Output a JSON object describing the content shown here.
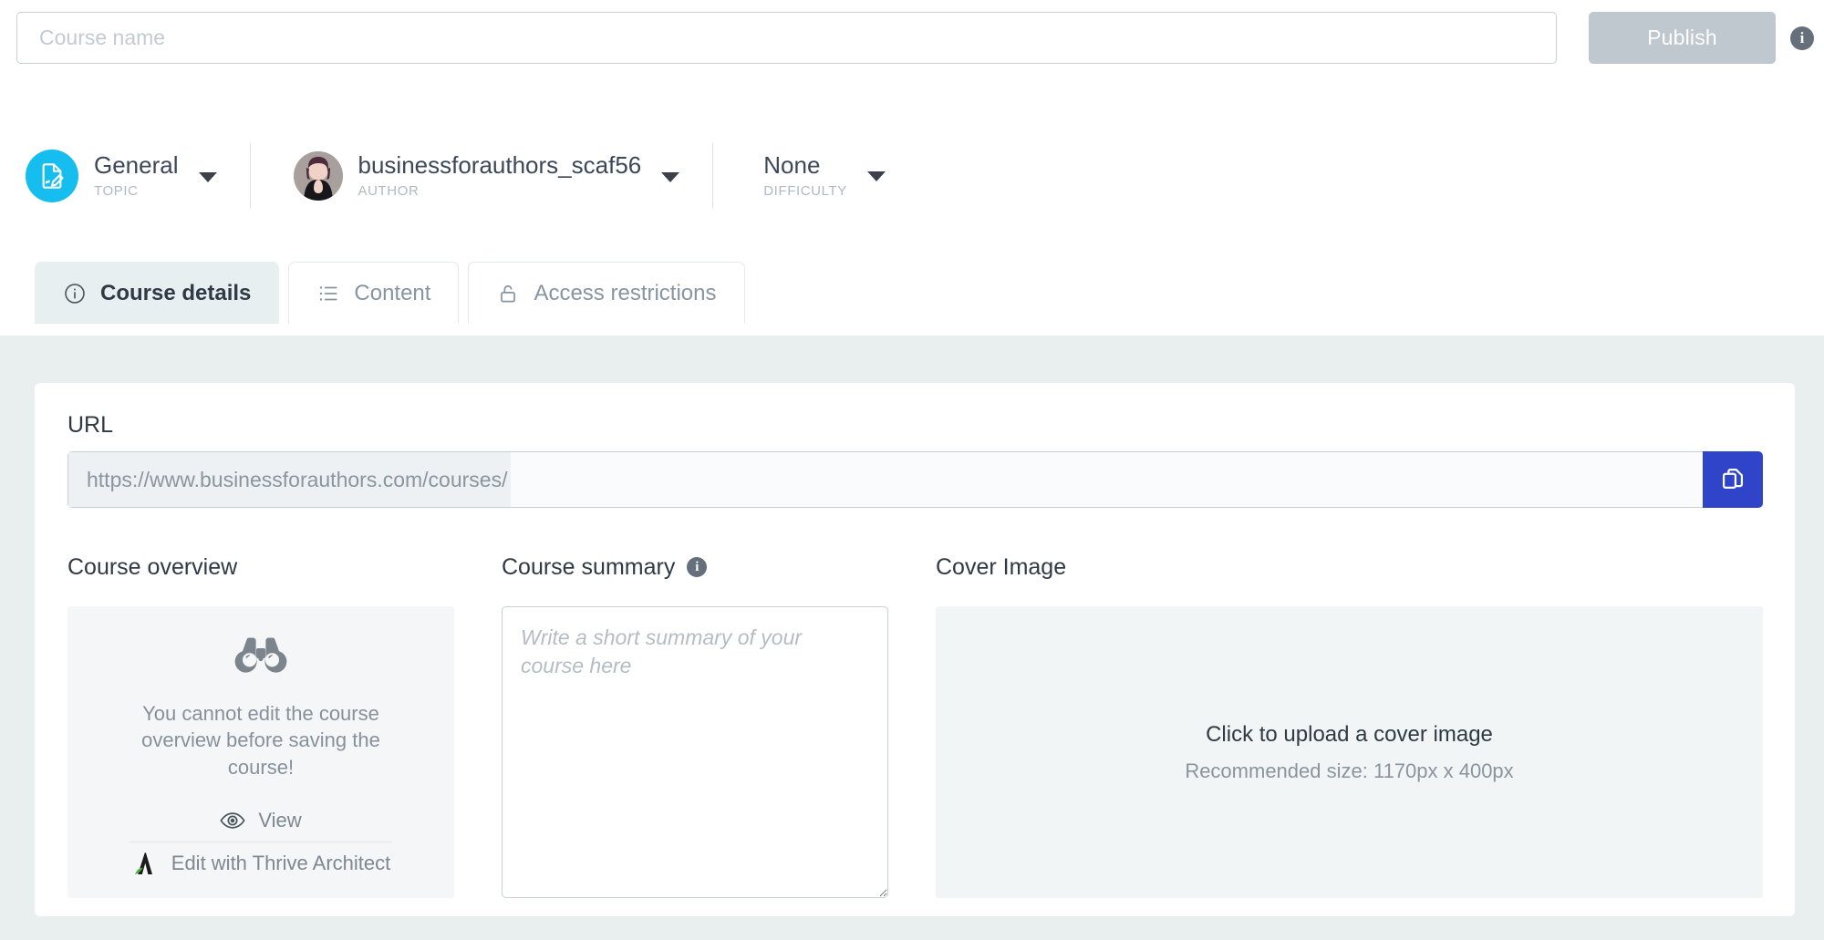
{
  "topbar": {
    "course_name_placeholder": "Course name",
    "course_name_value": "",
    "publish_label": "Publish",
    "info_glyph": "i"
  },
  "meta": {
    "topic": {
      "value": "General",
      "label": "TOPIC",
      "icon": "document-pencil-icon",
      "color": "#16bdef"
    },
    "author": {
      "value": "businessforauthors_scaf56",
      "label": "AUTHOR",
      "icon": "avatar"
    },
    "difficulty": {
      "value": "None",
      "label": "DIFFICULTY"
    }
  },
  "tabs": [
    {
      "label": "Course details",
      "icon": "info-icon",
      "active": true
    },
    {
      "label": "Content",
      "icon": "list-icon",
      "active": false
    },
    {
      "label": "Access restrictions",
      "icon": "lock-icon",
      "active": false
    }
  ],
  "url": {
    "label": "URL",
    "prefix": "https://www.businessforauthors.com/courses/",
    "value": "",
    "copy_icon": "copy-icon",
    "copy_color": "#2f44c9"
  },
  "overview": {
    "title": "Course overview",
    "icon": "binoculars-icon",
    "message": "You cannot edit the course overview before saving the course!",
    "view_label": "View",
    "view_icon": "eye-icon",
    "edit_label": "Edit with Thrive Architect",
    "edit_icon": "thrive-architect-icon"
  },
  "summary": {
    "title": "Course summary",
    "info_glyph": "i",
    "placeholder": "Write a short summary of your course here",
    "value": ""
  },
  "cover": {
    "title": "Cover Image",
    "upload_label": "Click to upload a cover image",
    "recommended_label": "Recommended size: 1170px x 400px"
  }
}
